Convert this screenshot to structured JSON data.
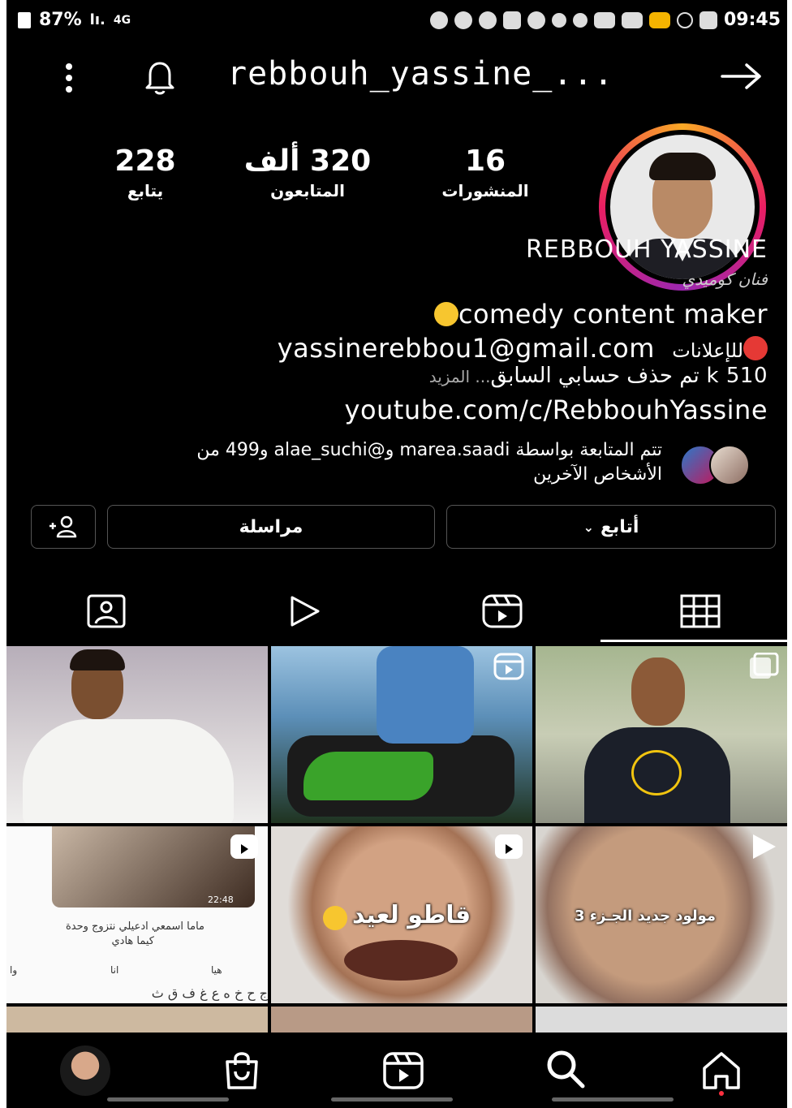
{
  "status_bar": {
    "battery": "87%",
    "signal": "lı.",
    "network": "4G",
    "time": "09:45"
  },
  "header": {
    "username": "rebbouh_yassine_...",
    "icons": [
      "more-vertical-icon",
      "bell-icon",
      "arrow-right-icon"
    ]
  },
  "stats": {
    "posts": {
      "value": "16",
      "label": "المنشورات"
    },
    "followers": {
      "value": "320 ألف",
      "label": "المتابعون"
    },
    "following": {
      "value": "228",
      "label": "يتابع"
    }
  },
  "bio": {
    "name": "REBBOUH YASSINE",
    "category": "فنان كوميدي",
    "line1": "comedy content maker",
    "line2_email": "yassinerebbou1@gmail.com",
    "line2_label": "للإعلانات",
    "line3": "k 510 تم حذف حسابي السابق",
    "line3_more": "... المزيد",
    "link": "youtube.com/c/RebbouhYassine",
    "followed_by_line1": "تتم المتابعة بواسطة marea.saadi و@alae_suchi و499 من",
    "followed_by_line2": "الأشخاص الآخرين"
  },
  "actions": {
    "follow": "أتابع",
    "message": "مراسلة",
    "add_user_icon": "add-person-icon"
  },
  "tabs": [
    "tagged-icon",
    "play-icon",
    "reels-icon",
    "grid-icon"
  ],
  "grid": {
    "captions": {
      "tile5": "قاطو لعيد",
      "tile6": "مولود جديد الجـزء 3"
    },
    "tile4_chat": {
      "time": "22:48",
      "msg1": "ماما اسمعي ادعيلي نتزوج وحدة",
      "msg2": "كيما هادي",
      "suggest1": "هيا",
      "suggest2": "انا",
      "suggest3": "وا",
      "keys": "ج ح خ ه ع غ ف ق ث"
    }
  },
  "bottom_nav": [
    "profile-avatar",
    "shop-icon",
    "reels-icon",
    "search-icon",
    "home-icon"
  ],
  "colors": {
    "background": "#000000",
    "text": "#ffffff",
    "border": "#555555",
    "ring": "#e91e63",
    "notification_dot": "#ff3040"
  }
}
